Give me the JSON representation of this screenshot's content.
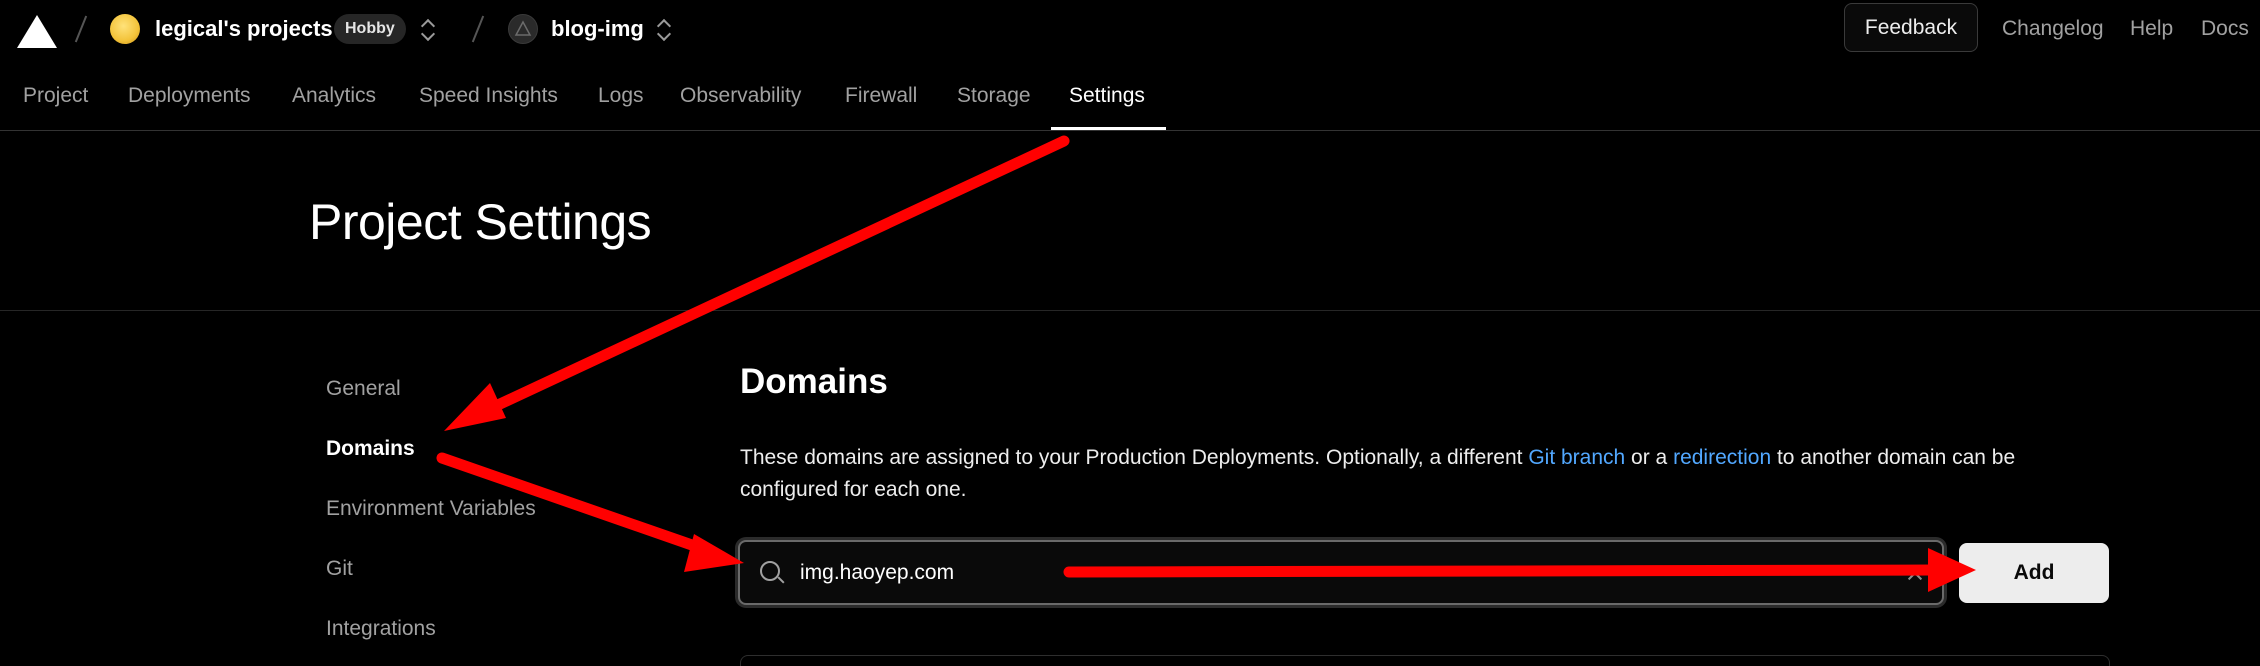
{
  "header": {
    "team_name": "legical's projects",
    "plan_badge": "Hobby",
    "project_name": "blog-img",
    "feedback": "Feedback",
    "changelog": "Changelog",
    "help": "Help",
    "docs": "Docs"
  },
  "tabs": [
    {
      "label": "Project"
    },
    {
      "label": "Deployments"
    },
    {
      "label": "Analytics"
    },
    {
      "label": "Speed Insights"
    },
    {
      "label": "Logs"
    },
    {
      "label": "Observability"
    },
    {
      "label": "Firewall"
    },
    {
      "label": "Storage"
    },
    {
      "label": "Settings",
      "active": true
    }
  ],
  "page": {
    "title": "Project Settings"
  },
  "sidebar": {
    "items": [
      {
        "label": "General"
      },
      {
        "label": "Domains",
        "active": true
      },
      {
        "label": "Environment Variables"
      },
      {
        "label": "Git"
      },
      {
        "label": "Integrations"
      }
    ]
  },
  "domains": {
    "title": "Domains",
    "description_1": "These domains are assigned to your Production Deployments. Optionally, a different ",
    "link_git_branch": "Git branch",
    "description_2": " or a ",
    "link_redirection": "redirection",
    "description_3": " to another domain can be configured for each one.",
    "input_value": "img.haoyep.com",
    "add_button": "Add"
  },
  "colors": {
    "accent_link": "#52a8ff",
    "annotation_arrow": "#ff0000",
    "background": "#000000"
  },
  "icons": [
    "vercel-logo-icon",
    "team-avatar-icon",
    "project-avatar-icon",
    "chevron-updown-icon",
    "search-icon",
    "clear-icon"
  ]
}
